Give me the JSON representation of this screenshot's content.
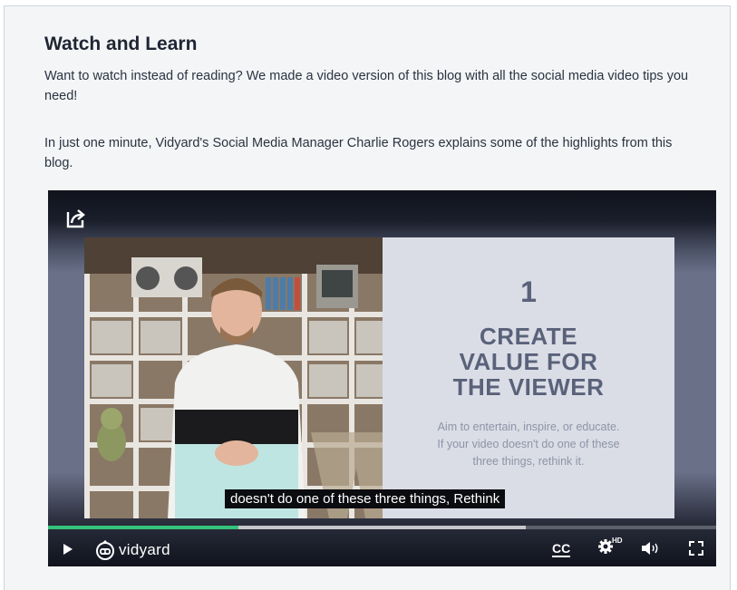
{
  "section": {
    "heading": "Watch and Learn",
    "paragraph1": "Want to watch instead of reading? We made a video version of this blog with all the social media video tips you need!",
    "paragraph2": "In just one minute, Vidyard's Social Media Manager Charlie Rogers explains some of the highlights from this blog."
  },
  "player": {
    "slide": {
      "number": "1",
      "title_lines": [
        "CREATE",
        "VALUE FOR",
        "THE VIEWER"
      ],
      "subtitle_lines": [
        "Aim to entertain, inspire, or educate.",
        "If your video doesn't do one of these",
        "three things, rethink it."
      ]
    },
    "caption": "doesn't do one of these three things, Rethink",
    "progress": 0.285,
    "buffered": 0.715,
    "brand": "vidyard",
    "cc_label": "CC",
    "hd_label": "HD",
    "icons": {
      "share": "share-icon",
      "play": "play-icon",
      "settings": "gear-icon",
      "volume": "volume-icon",
      "fullscreen": "fullscreen-icon"
    },
    "colors": {
      "progress": "#35c27a",
      "slide_text": "#5a627a"
    }
  }
}
